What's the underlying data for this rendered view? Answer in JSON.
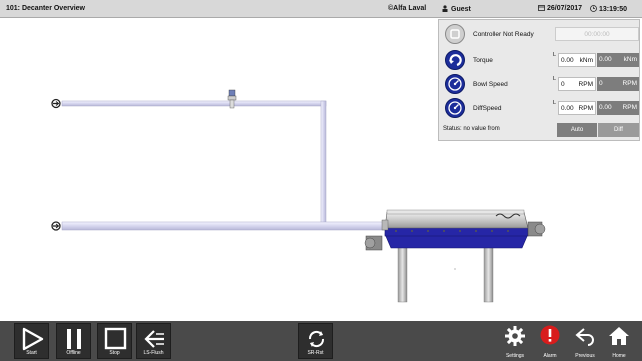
{
  "topbar": {
    "title": "101: Decanter Overview",
    "copyright": "©Alfa Laval",
    "user": "Guest",
    "date": "26/07/2017",
    "time": "13:19:50"
  },
  "panel": {
    "controller": {
      "label": "Controller Not Ready",
      "timer": "00:00:00"
    },
    "rows": [
      {
        "label": "Torque",
        "value": "0.00",
        "unit": "kNm",
        "value2": "0.00",
        "unit2": "kNm"
      },
      {
        "label": "Bowl Speed",
        "value": "0",
        "unit": "RPM",
        "value2": "0",
        "unit2": "RPM"
      },
      {
        "label": "DiffSpeed",
        "value": "0.00",
        "unit": "RPM",
        "value2": "0.00",
        "unit2": "RPM"
      }
    ],
    "l_marker": "L",
    "status": "Status: no value from",
    "auto_label": "Auto",
    "diff_label": "Diff"
  },
  "bottombar": {
    "start": "Start",
    "offline": "Offline",
    "stop": "Stop",
    "ls_flush": "LS-Flush",
    "sr_rst": "SR-Rst",
    "settings": "Settings",
    "alarm": "Alarm",
    "previous": "Previous",
    "home": "Home"
  },
  "colors": {
    "accent_blue": "#1c2d9a",
    "alarm_red": "#d81c1c",
    "pipe": "#d9d9ef"
  },
  "icons": [
    "user-icon",
    "calendar-icon",
    "clock-icon",
    "controller-icon",
    "torque-icon",
    "gauge-icon",
    "start-icon",
    "pause-icon",
    "stop-icon",
    "ls-flush-icon",
    "sr-reset-icon",
    "settings-icon",
    "alarm-icon",
    "previous-icon",
    "home-icon"
  ]
}
